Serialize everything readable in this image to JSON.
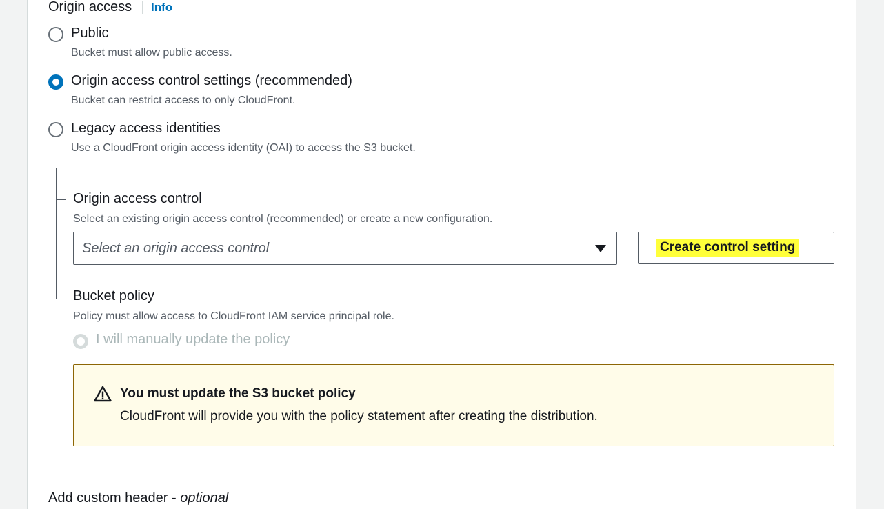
{
  "origin_access": {
    "label": "Origin access",
    "info_link": "Info",
    "options": [
      {
        "label": "Public",
        "description": "Bucket must allow public access.",
        "selected": false
      },
      {
        "label": "Origin access control settings (recommended)",
        "description": "Bucket can restrict access to only CloudFront.",
        "selected": true
      },
      {
        "label": "Legacy access identities",
        "description": "Use a CloudFront origin access identity (OAI) to access the S3 bucket.",
        "selected": false
      }
    ]
  },
  "origin_access_control": {
    "label": "Origin access control",
    "description": "Select an existing origin access control (recommended) or create a new configuration.",
    "select_placeholder": "Select an origin access control",
    "create_button_label": "Create control setting"
  },
  "bucket_policy": {
    "label": "Bucket policy",
    "description": "Policy must allow access to CloudFront IAM service principal role.",
    "option_label": "I will manually update the policy"
  },
  "alert": {
    "title": "You must update the S3 bucket policy",
    "body": "CloudFront will provide you with the policy statement after creating the distribution.",
    "accent_color": "#8d6605"
  },
  "custom_header": {
    "label": "Add custom header - ",
    "optional": "optional"
  }
}
